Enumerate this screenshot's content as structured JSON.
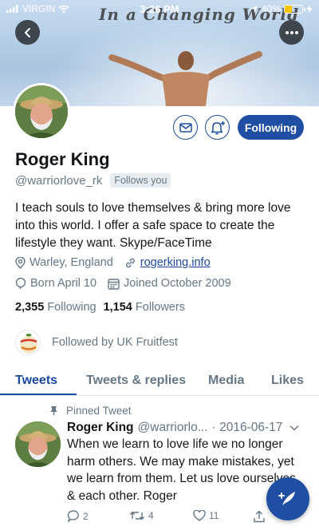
{
  "status_bar": {
    "carrier": "VIRGIN",
    "time": "3:26 PM",
    "battery_percent": "40%",
    "battery_level": 0.4
  },
  "banner": {
    "title": "In a Changing World"
  },
  "profile": {
    "name": "Roger King",
    "handle": "@warriorlove_rk",
    "follows_you": "Follows you",
    "bio": "I teach souls to love themselves & bring more love into this world. I offer a safe space to create the lifestyle they want. Skype/FaceTime",
    "location": "Warley, England",
    "website": "rogerking.info",
    "born": "Born April 10",
    "joined": "Joined October 2009",
    "following_count": "2,355",
    "following_label": "Following",
    "followers_count": "1,154",
    "followers_label": "Followers",
    "followed_by": "Followed by UK Fruitfest",
    "follow_button": "Following"
  },
  "tabs": [
    "Tweets",
    "Tweets & replies",
    "Media",
    "Likes"
  ],
  "tweet": {
    "pinned_label": "Pinned Tweet",
    "author": "Roger King",
    "handle_trunc": "@warriorlo...",
    "date": "· 2016-06-17",
    "text": "When we learn to love life we no longer harm others. We may make mistakes, yet we learn from them. Let us love ourselves & each other. Roger",
    "replies": "2",
    "retweets": "4",
    "likes": "11"
  },
  "colors": {
    "accent": "#1f4ea3",
    "muted": "#657786"
  },
  "icons": {
    "back": "back-arrow-icon",
    "more": "more-icon",
    "message": "envelope-icon",
    "notify": "bell-plus-icon",
    "compose": "feather-icon"
  }
}
